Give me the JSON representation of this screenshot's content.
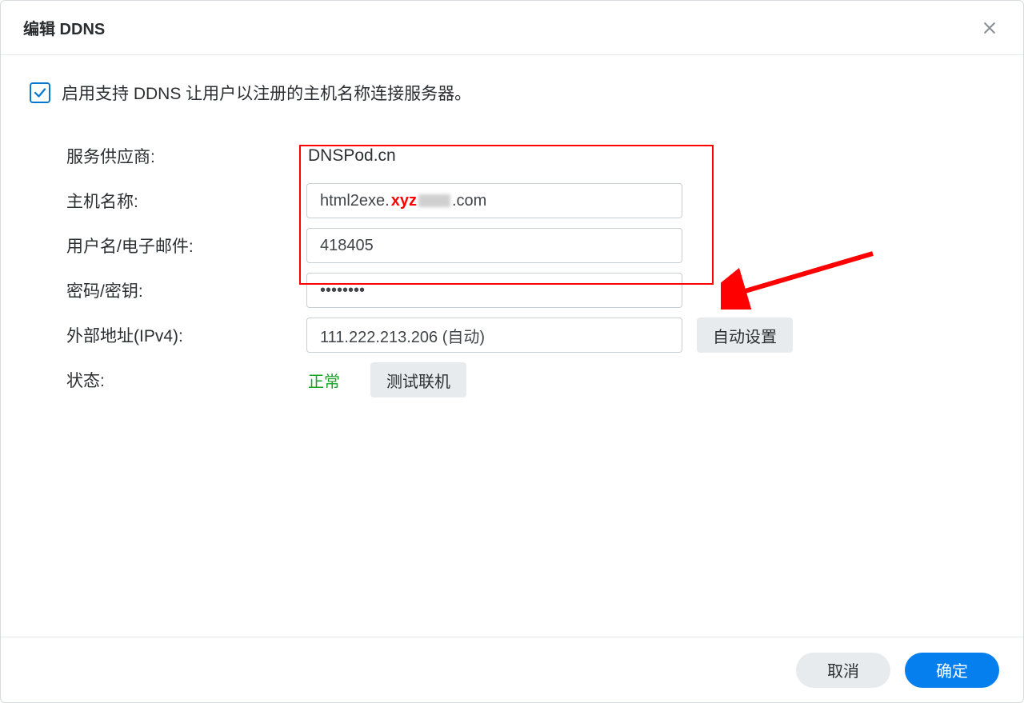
{
  "dialog": {
    "title": "编辑 DDNS"
  },
  "enable": {
    "label": "启用支持 DDNS 让用户以注册的主机名称连接服务器。"
  },
  "labels": {
    "provider": "服务供应商:",
    "hostname": "主机名称:",
    "username": "用户名/电子邮件:",
    "password": "密码/密钥:",
    "external_ip": "外部地址(IPv4):",
    "status": "状态:"
  },
  "values": {
    "provider": "DNSPod.cn",
    "hostname_prefix": "html2exe.",
    "hostname_masked": "xyz",
    "hostname_suffix": ".com",
    "username": "418405",
    "password": "••••••••",
    "external_ip": "111.222.213.206 (自动)",
    "status": "正常"
  },
  "buttons": {
    "auto_set": "自动设置",
    "test_conn": "测试联机",
    "cancel": "取消",
    "ok": "确定"
  }
}
